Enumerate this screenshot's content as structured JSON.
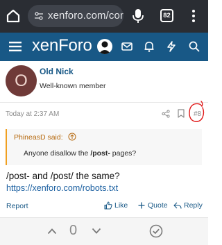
{
  "browser": {
    "url": "xenforo.com/com",
    "tab_count": "82",
    "icons": [
      "home-icon",
      "lock-icon",
      "mic-icon",
      "tabs-icon",
      "overflow-menu-icon"
    ]
  },
  "site_header": {
    "logo": "xenForo",
    "icons": [
      "hamburger-icon",
      "avatar-icon",
      "inbox-icon",
      "bell-icon",
      "bolt-icon",
      "search-icon"
    ],
    "bg_color": "#185886"
  },
  "post": {
    "avatar_letter": "O",
    "username": "Old Nick",
    "user_title": "Well-known member",
    "timestamp": "Today at 2:37 AM",
    "post_number": "#8",
    "quote": {
      "author": "PhineasD said:",
      "text_before": "Anyone disallow the ",
      "text_bold": "/post-",
      "text_after": " pages?"
    },
    "body_text": "/post- and /post/ the same?",
    "body_link": "https://xenforo.com/robots.txt",
    "actions": {
      "report": "Report",
      "like": "Like",
      "quote": "Quote",
      "reply": "Reply"
    }
  },
  "vote_bar": {
    "count": "0"
  },
  "colors": {
    "link": "#185886",
    "quote_accent": "#f0a020",
    "annotation": "#e01818"
  }
}
